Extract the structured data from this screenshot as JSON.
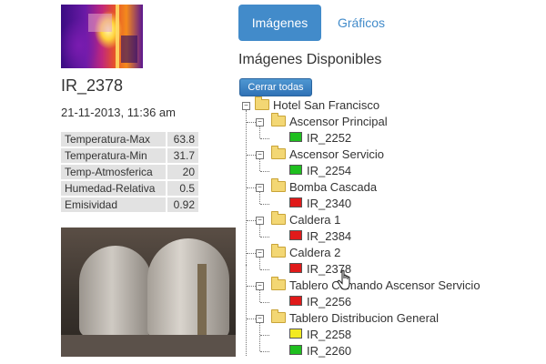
{
  "image": {
    "name": "IR_2378",
    "datetime": "21-11-2013, 11:36 am"
  },
  "stats": [
    {
      "label": "Temperatura-Max",
      "value": "63.8"
    },
    {
      "label": "Temperatura-Min",
      "value": "31.7"
    },
    {
      "label": "Temp-Atmosferica",
      "value": "20"
    },
    {
      "label": "Humedad-Relativa",
      "value": "0.5"
    },
    {
      "label": "Emisividad",
      "value": "0.92"
    }
  ],
  "tabs": [
    {
      "label": "Imágenes",
      "active": true
    },
    {
      "label": "Gráficos",
      "active": false
    }
  ],
  "section_title": "Imágenes Disponibles",
  "close_all_label": "Cerrar todas",
  "tree": {
    "root": "Hotel San Francisco",
    "folders": [
      {
        "label": "Ascensor Principal",
        "items": [
          {
            "label": "IR_2252",
            "status": "green"
          }
        ]
      },
      {
        "label": "Ascensor Servicio",
        "items": [
          {
            "label": "IR_2254",
            "status": "green"
          }
        ]
      },
      {
        "label": "Bomba Cascada",
        "items": [
          {
            "label": "IR_2340",
            "status": "red"
          }
        ]
      },
      {
        "label": "Caldera 1",
        "items": [
          {
            "label": "IR_2384",
            "status": "red"
          }
        ]
      },
      {
        "label": "Caldera 2",
        "items": [
          {
            "label": "IR_2378",
            "status": "red"
          }
        ]
      },
      {
        "label": "Tablero Comando Ascensor Servicio",
        "items": [
          {
            "label": "IR_2256",
            "status": "red"
          }
        ]
      },
      {
        "label": "Tablero Distribucion General",
        "items": [
          {
            "label": "IR_2258",
            "status": "yellow"
          },
          {
            "label": "IR_2260",
            "status": "green"
          }
        ]
      }
    ]
  },
  "status_colors": {
    "green": "#1fbf1f",
    "red": "#e01a1a",
    "yellow": "#f2ea22"
  },
  "accent_color": "#428bca"
}
